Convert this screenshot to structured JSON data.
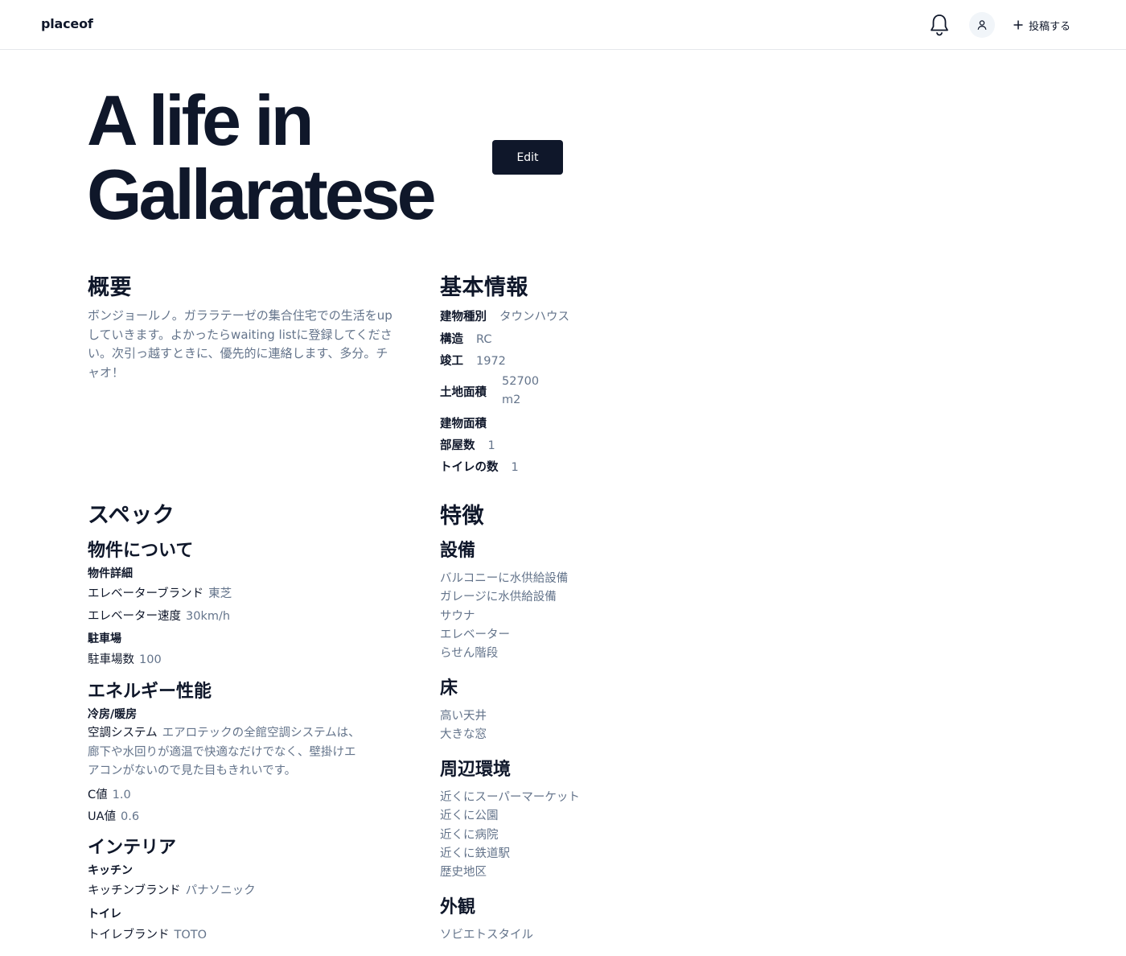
{
  "header": {
    "logo": "placeof",
    "post_label": "投稿する"
  },
  "title": "A life in Gallaratese",
  "edit_label": "Edit",
  "overview": {
    "heading": "概要",
    "text": "ボンジョールノ。ガララテーゼの集合住宅での生活をupしていきます。よかったらwaiting listに登録してください。次引っ越すときに、優先的に連絡します、多分。チャオ！"
  },
  "basic": {
    "heading": "基本情報",
    "building_type_label": "建物種別",
    "building_type": "タウンハウス",
    "structure_label": "構造",
    "structure": "RC",
    "completed_label": "竣工",
    "completed": "1972",
    "land_area_label": "土地面積",
    "land_area_line1": "52700",
    "land_area_line2": "m2",
    "building_area_label": "建物面積",
    "rooms_label": "部屋数",
    "rooms": "1",
    "toilets_label": "トイレの数",
    "toilets": "1"
  },
  "spec": {
    "heading": "スペック",
    "property_heading": "物件について",
    "details_heading": "物件詳細",
    "elevator_brand_label": "エレベーターブランド",
    "elevator_brand": "東芝",
    "elevator_speed_label": "エレベーター速度",
    "elevator_speed": "30km/h",
    "parking_heading": "駐車場",
    "parking_count_label": "駐車場数",
    "parking_count": "100",
    "energy_heading": "エネルギー性能",
    "hvac_heading": "冷房/暖房",
    "hvac_label": "空調システム",
    "hvac_line1": "エアロテックの全館空調システムは、",
    "hvac_line2": "廊下や水回りが適温で快適なだけでなく、壁掛けエ",
    "hvac_line3": "アコンがないので見た目もきれいです。",
    "c_label": "C値",
    "c_value": "1.0",
    "ua_label": "UA値",
    "ua_value": "0.6",
    "interior_heading": "インテリア",
    "kitchen_heading": "キッチン",
    "kitchen_brand_label": "キッチンブランド",
    "kitchen_brand": "パナソニック",
    "toilet_heading": "トイレ",
    "toilet_brand_label": "トイレブランド",
    "toilet_brand": "TOTO"
  },
  "features": {
    "heading": "特徴",
    "equipment_heading": "設備",
    "equipment": [
      "バルコニーに水供給設備",
      "ガレージに水供給設備",
      "サウナ",
      "エレベーター",
      "らせん階段"
    ],
    "floor_heading": "床",
    "floor": [
      "高い天井",
      "大きな窓"
    ],
    "surroundings_heading": "周辺環境",
    "surroundings": [
      "近くにスーパーマーケット",
      "近くに公園",
      "近くに病院",
      "近くに鉄道駅",
      "歴史地区"
    ],
    "exterior_heading": "外観",
    "exterior": [
      "ソビエトスタイル"
    ]
  }
}
